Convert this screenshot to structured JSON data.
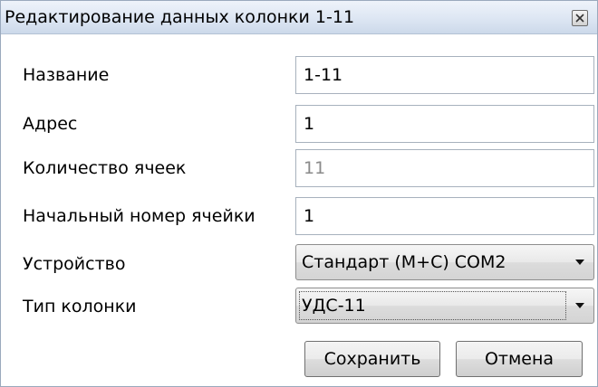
{
  "window": {
    "title": "Редактирование данных колонки 1-11",
    "close_icon": "close-icon"
  },
  "form": {
    "name_label": "Название",
    "name_value": "1-11",
    "address_label": "Адрес",
    "address_value": "1",
    "cell_count_label": "Количество ячеек",
    "cell_count_value": "11",
    "start_cell_label": "Начальный номер ячейки",
    "start_cell_value": "1",
    "device_label": "Устройство",
    "device_value": "Стандарт (М+С) COM2",
    "column_type_label": "Тип колонки",
    "column_type_value": "УДС-11"
  },
  "buttons": {
    "save_label": "Сохранить",
    "cancel_label": "Отмена"
  },
  "colors": {
    "titlebar": "#dde6f3",
    "border": "#9aa9bd",
    "readonly_text": "#8a8a8a"
  }
}
